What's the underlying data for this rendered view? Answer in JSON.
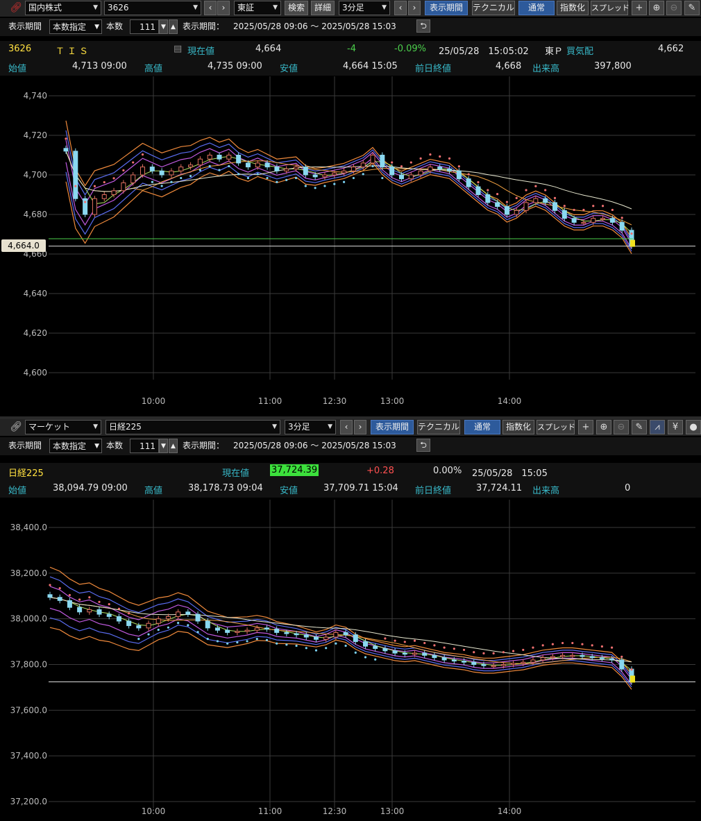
{
  "panel1": {
    "toolbar": {
      "market": "国内株式",
      "code": "3626",
      "exchange": "東証",
      "search_label": "検索",
      "detail_label": "詳細",
      "interval": "3分足",
      "period_label": "表示期間",
      "technical_label": "テクニカル",
      "normal_label": "通常",
      "index_label": "指数化",
      "spread_label": "スプレッド"
    },
    "row2": {
      "period_label": "表示期間",
      "period_mode": "本数指定",
      "count_label": "本数",
      "count_value": "111",
      "range_label": "表示期間：",
      "range_value": "2025/05/28 09:06 ～ 2025/05/28 15:03"
    },
    "quote": {
      "code": "3626",
      "name": "ＴＩＳ",
      "current_label": "現在値",
      "current_value": "4,664",
      "change": "-4",
      "change_pct": "-0.09%",
      "datetime": "25/05/28　15:05:02",
      "market": "東Ｐ",
      "bid_label": "買気配",
      "bid_value": "4,662",
      "open_label": "始値",
      "open_value": "4,713 09:00",
      "high_label": "高値",
      "high_value": "4,735 09:00",
      "low_label": "安値",
      "low_value": "4,664 15:05",
      "prev_label": "前日終値",
      "prev_value": "4,668",
      "volume_label": "出来高",
      "volume_value": "397,800"
    },
    "chart_data": {
      "type": "candlestick",
      "y_ticks": [
        "4,740",
        "4,720",
        "4,700",
        "4,680",
        "4,660",
        "4,640",
        "4,620",
        "4,600"
      ],
      "y_tick_values": [
        4740,
        4720,
        4700,
        4680,
        4660,
        4640,
        4620,
        4600
      ],
      "ylim": [
        4600,
        4740
      ],
      "x_ticks": [
        "10:00",
        "11:00",
        "12:30",
        "13:00",
        "14:00"
      ],
      "price_label": "4,664.0",
      "last_price": 4664,
      "close_series": [
        4712,
        4688,
        4680,
        4688,
        4690,
        4692,
        4696,
        4700,
        4704,
        4702,
        4700,
        4702,
        4704,
        4705,
        4708,
        4710,
        4708,
        4710,
        4706,
        4704,
        4706,
        4704,
        4702,
        4703,
        4704,
        4700,
        4699,
        4700,
        4701,
        4702,
        4704,
        4706,
        4710,
        4704,
        4700,
        4698,
        4700,
        4702,
        4704,
        4703,
        4702,
        4698,
        4694,
        4690,
        4686,
        4684,
        4680,
        4682,
        4686,
        4688,
        4686,
        4682,
        4678,
        4676,
        4676,
        4678,
        4678,
        4676,
        4672,
        4664
      ]
    }
  },
  "panel2": {
    "toolbar": {
      "market": "マーケット",
      "code": "日経225",
      "interval": "3分足",
      "period_label": "表示期間",
      "technical_label": "テクニカル",
      "normal_label": "通常",
      "index_label": "指数化",
      "spread_label": "スプレッド"
    },
    "row2": {
      "period_label": "表示期間",
      "period_mode": "本数指定",
      "count_label": "本数",
      "count_value": "111",
      "range_label": "表示期間：",
      "range_value": "2025/05/28 09:06 ～ 2025/05/28 15:03"
    },
    "quote": {
      "name": "日経225",
      "current_label": "現在値",
      "current_value": "37,724.39",
      "change": "+0.28",
      "change_pct": "0.00%",
      "datetime": "25/05/28　15:05",
      "open_label": "始値",
      "open_value": "38,094.79 09:00",
      "high_label": "高値",
      "high_value": "38,178.73 09:04",
      "low_label": "安値",
      "low_value": "37,709.71 15:04",
      "prev_label": "前日終値",
      "prev_value": "37,724.11",
      "volume_label": "出来高",
      "volume_value": "0"
    },
    "chart_data": {
      "type": "candlestick",
      "y_ticks": [
        "38,400.0",
        "38,200.0",
        "38,000.0",
        "37,800.0",
        "37,600.0",
        "37,400.0",
        "37,200.0"
      ],
      "y_tick_values": [
        38400,
        38200,
        38000,
        37800,
        37600,
        37400,
        37200
      ],
      "ylim": [
        37200,
        38400
      ],
      "x_ticks": [
        "10:00",
        "11:00",
        "12:30",
        "13:00",
        "14:00"
      ],
      "last_price": 37724,
      "close_series": [
        38094,
        38080,
        38050,
        38030,
        38040,
        38020,
        38010,
        37990,
        37970,
        37960,
        37980,
        38000,
        38010,
        38030,
        38020,
        37990,
        37960,
        37950,
        37940,
        37945,
        37950,
        37960,
        37955,
        37940,
        37935,
        37930,
        37920,
        37910,
        37920,
        37940,
        37930,
        37900,
        37880,
        37870,
        37860,
        37850,
        37845,
        37850,
        37840,
        37830,
        37820,
        37815,
        37810,
        37800,
        37795,
        37795,
        37800,
        37805,
        37810,
        37820,
        37830,
        37835,
        37840,
        37840,
        37835,
        37830,
        37825,
        37820,
        37780,
        37724
      ]
    }
  }
}
